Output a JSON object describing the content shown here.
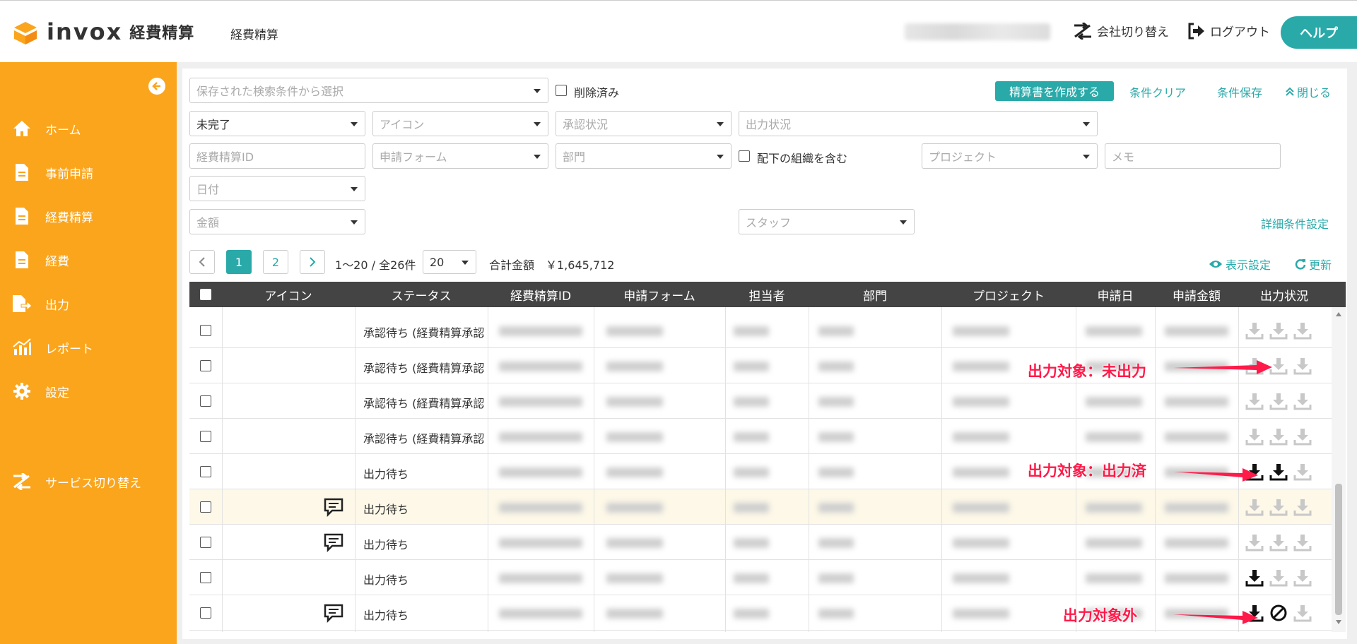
{
  "header": {
    "logo_text": "invox",
    "logo_sub": "経費精算",
    "app_name": "経費精算",
    "switch_company": "会社切り替え",
    "logout": "ログアウト",
    "help": "ヘルプ"
  },
  "sidebar": {
    "items": [
      {
        "label": "ホーム",
        "icon": "home-icon"
      },
      {
        "label": "事前申請",
        "icon": "document-icon"
      },
      {
        "label": "経費精算",
        "icon": "document-icon"
      },
      {
        "label": "経費",
        "icon": "document-icon"
      },
      {
        "label": "出力",
        "icon": "export-document-icon"
      },
      {
        "label": "レポート",
        "icon": "chart-icon"
      },
      {
        "label": "設定",
        "icon": "gear-icon"
      }
    ],
    "service_switch": "サービス切り替え"
  },
  "filters": {
    "saved_search_placeholder": "保存された検索条件から選択",
    "deleted_label": "削除済み",
    "create_button": "精算書を作成する",
    "clear": "条件クリア",
    "save": "条件保存",
    "close": "閉じる",
    "status_value": "未完了",
    "icon_placeholder": "アイコン",
    "approval_placeholder": "承認状況",
    "output_placeholder": "出力状況",
    "id_placeholder": "経費精算ID",
    "form_placeholder": "申請フォーム",
    "dept_placeholder": "部門",
    "include_sub_label": "配下の組織を含む",
    "project_placeholder": "プロジェクト",
    "memo_placeholder": "メモ",
    "date_placeholder": "日付",
    "amount_placeholder": "金額",
    "staff_placeholder": "スタッフ",
    "advanced": "詳細条件設定"
  },
  "pagination": {
    "page1": "1",
    "page2": "2",
    "range": "1〜20 / 全26件",
    "per_page": "20",
    "total_label": "合計金額",
    "total_value": "￥1,645,712",
    "display_settings": "表示設定",
    "refresh": "更新"
  },
  "table": {
    "columns": [
      "アイコン",
      "ステータス",
      "経費精算ID",
      "申請フォーム",
      "担当者",
      "部門",
      "プロジェクト",
      "申請日",
      "申請金額",
      "出力状況"
    ],
    "rows": [
      {
        "status": "承認待ち (経費精算承認",
        "comment": false,
        "outputs": [
          "none",
          "none",
          "none"
        ]
      },
      {
        "status": "承認待ち (経費精算承認",
        "comment": false,
        "outputs": [
          "none",
          "none",
          "none"
        ]
      },
      {
        "status": "承認待ち (経費精算承認",
        "comment": false,
        "outputs": [
          "none",
          "none",
          "none"
        ]
      },
      {
        "status": "承認待ち (経費精算承認",
        "comment": false,
        "outputs": [
          "none",
          "none",
          "none"
        ]
      },
      {
        "status": "出力待ち",
        "comment": false,
        "outputs": [
          "done",
          "done",
          "none"
        ]
      },
      {
        "status": "出力待ち",
        "comment": true,
        "outputs": [
          "none",
          "none",
          "none"
        ]
      },
      {
        "status": "出力待ち",
        "comment": true,
        "outputs": [
          "none",
          "none",
          "none"
        ]
      },
      {
        "status": "出力待ち",
        "comment": false,
        "outputs": [
          "done",
          "none",
          "none"
        ]
      },
      {
        "status": "出力待ち",
        "comment": true,
        "outputs": [
          "done",
          "excluded",
          "none"
        ]
      }
    ]
  },
  "annotations": {
    "not_output": "出力対象：未出力",
    "output_done": "出力対象：出力済",
    "excluded": "出力対象外"
  },
  "colors": {
    "sidebar": "#fba51c",
    "accent": "#2aa9a9",
    "annotation": "#ff1a4a"
  }
}
